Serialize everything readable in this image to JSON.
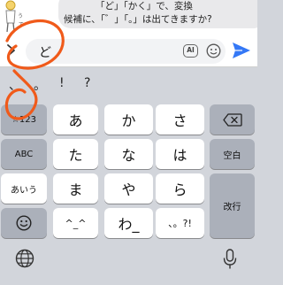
{
  "chat": {
    "line1": "「ど」「かく」で、変換",
    "line2": "候補に、「゛」「。」は出てきますか?"
  },
  "input": {
    "typed_text": "ど",
    "ai_label": "AI"
  },
  "suggestions": [
    "、",
    "。",
    "!",
    "?"
  ],
  "keyboard": {
    "rows": [
      [
        "☆123",
        "あ",
        "か",
        "さ"
      ],
      [
        "ABC",
        "た",
        "な",
        "は",
        "空白"
      ],
      [
        "あいう",
        "ま",
        "や",
        "ら"
      ],
      [
        "^_^",
        "わ_",
        "、。?!",
        "改行"
      ]
    ],
    "punct_key": "、。?!",
    "wa_key": "わ_",
    "kaomoji_key": "^_^",
    "space_key": "空白",
    "return_key": "改行"
  },
  "colors": {
    "send": "#3478f6",
    "annotation": "#f05a1a",
    "keyboard_bg": "#d2d5db",
    "function_key": "#abb0ba"
  }
}
